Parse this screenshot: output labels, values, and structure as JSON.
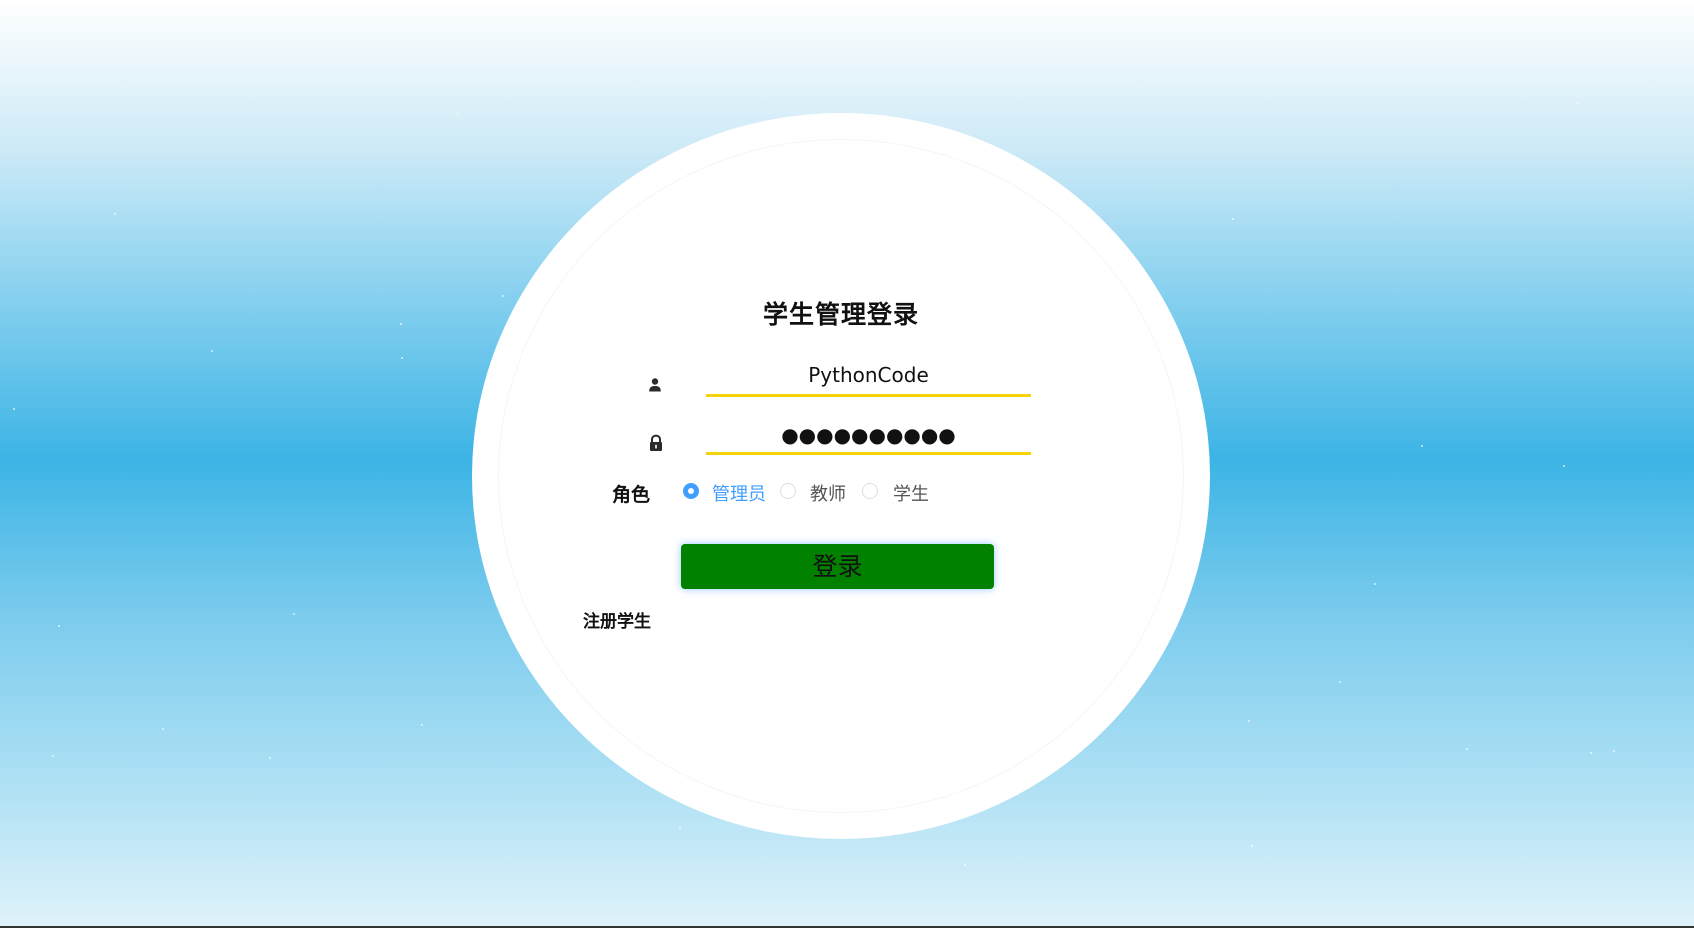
{
  "login": {
    "title": "学生管理登录",
    "username_value": "PythonCode",
    "password_value": "●●●●●●●●●●",
    "role_label": "角色",
    "roles": [
      {
        "label": "管理员",
        "selected": true
      },
      {
        "label": "教师",
        "selected": false
      },
      {
        "label": "学生",
        "selected": false
      }
    ],
    "login_button_label": "登录",
    "register_link": "注册学生"
  },
  "icons": {
    "username": "user-icon",
    "password": "lock-icon"
  },
  "colors": {
    "login_button": "#028000",
    "field_underline": "#f6d20c",
    "radio_selected": "#409eff"
  }
}
